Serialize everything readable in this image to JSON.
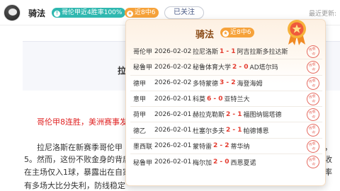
{
  "header": {
    "author": "骑法",
    "win_rate_badge": "哥伦甲近4胜率100%",
    "streak_badge": "近8中6",
    "follow_label": "已关注",
    "updated_label": "最近更新:"
  },
  "article": {
    "title_fragment": "拉",
    "headline": "哥伦甲8连胜，美洲赛事发",
    "lines": [
      "拉尼洛斯在新赛季哥伦甲",
      "5。然而，这份不败金身的背后",
      "在主场仅入1球，暴露出在自家",
      "有多场大比分失利，防线稳定"
    ],
    "right_fragments": [
      "败，",
      "局收",
      "利率"
    ]
  },
  "popup": {
    "title": "骑法",
    "streak_badge": "近8中6",
    "stamp_text": "传奇|中",
    "matches": [
      {
        "league": "哥伦甲",
        "date": "2026-02-02",
        "home": "拉尼洛斯",
        "score": "1 - 1",
        "away": "阿吉拉斯多拉达斯"
      },
      {
        "league": "秘鲁甲",
        "date": "2026-02-02",
        "home": "秘鲁体育大学",
        "score": "2 - 0",
        "away": "AD塔尔玛"
      },
      {
        "league": "德甲",
        "date": "2026-02-02",
        "home": "多特蒙德",
        "score": "3 - 2",
        "away": "海登海姆"
      },
      {
        "league": "意甲",
        "date": "2026-02-01",
        "home": "科莫",
        "score": "6 - 0",
        "away": "亚特兰大"
      },
      {
        "league": "荷甲",
        "date": "2026-02-01",
        "home": "赫拉克勒斯",
        "score": "2 - 1",
        "away": "福图纳锡塔德"
      },
      {
        "league": "德乙",
        "date": "2026-02-01",
        "home": "杜塞尔多夫",
        "score": "2 - 1",
        "away": "帕德博恩"
      },
      {
        "league": "墨西联",
        "date": "2026-02-01",
        "home": "蒙特雷",
        "score": "2 - 2",
        "away": "蒂华纳"
      },
      {
        "league": "秘鲁甲",
        "date": "2026-02-01",
        "home": "梅尔加",
        "score": "2 - 0",
        "away": "西恩夏诺"
      }
    ]
  },
  "colors": {
    "accent_teal": "#2fb8b0",
    "accent_orange": "#f6a23a",
    "score_red": "#e43a2e",
    "headline_red": "#e02424"
  }
}
